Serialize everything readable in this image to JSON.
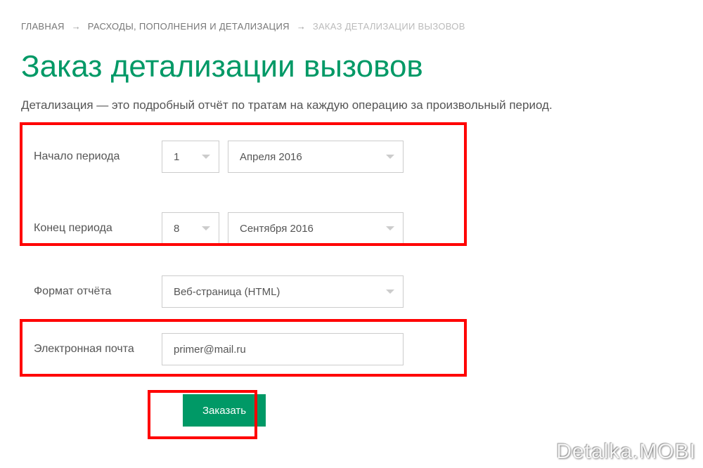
{
  "breadcrumb": {
    "home": "ГЛАВНАЯ",
    "section": "РАСХОДЫ, ПОПОЛНЕНИЯ И ДЕТАЛИЗАЦИЯ",
    "current": "ЗАКАЗ ДЕТАЛИЗАЦИИ ВЫЗОВОВ"
  },
  "page_title": "Заказ детализации вызовов",
  "description": "Детализация — это подробный отчёт по тратам на каждую операцию за произвольный период.",
  "form": {
    "start_label": "Начало периода",
    "start_day": "1",
    "start_month": "Апреля 2016",
    "end_label": "Конец периода",
    "end_day": "8",
    "end_month": "Сентября 2016",
    "format_label": "Формат отчёта",
    "format_value": "Веб-страница (HTML)",
    "email_label": "Электронная почта",
    "email_value": "primer@mail.ru",
    "submit_label": "Заказать"
  },
  "watermark": "Detalka.MOBI"
}
